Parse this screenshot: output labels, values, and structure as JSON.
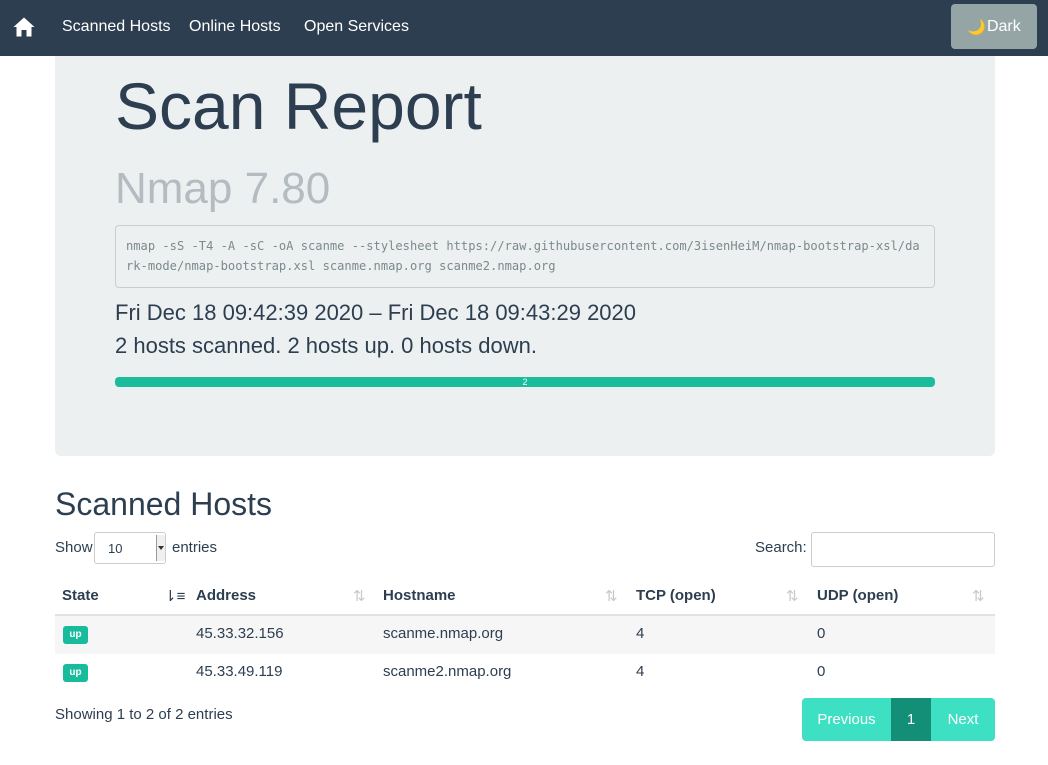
{
  "navbar": {
    "home_icon": "home-icon",
    "links": [
      "Scanned Hosts",
      "Online Hosts",
      "Open Services"
    ],
    "dark_button": {
      "icon": "🌙",
      "label": "Dark"
    }
  },
  "report": {
    "title": "Scan Report",
    "subtitle": "Nmap 7.80",
    "command": "nmap -sS -T4 -A -sC -oA scanme --stylesheet https://raw.githubusercontent.com/3isenHeiM/nmap-bootstrap-xsl/dark-mode/nmap-bootstrap.xsl scanme.nmap.org scanme2.nmap.org",
    "time_range": "Fri Dec 18 09:42:39 2020 – Fri Dec 18 09:43:29 2020",
    "summary": "2 hosts scanned. 2 hosts up. 0 hosts down.",
    "progress": {
      "label": "2",
      "value": 2,
      "total": 2
    }
  },
  "hosts_section": {
    "title": "Scanned Hosts",
    "show_label": "Show",
    "entries_value": "10",
    "entries_label": "entries",
    "search_label": "Search:",
    "search_value": "",
    "columns": [
      "State",
      "Address",
      "Hostname",
      "TCP (open)",
      "UDP (open)"
    ],
    "rows": [
      {
        "state": "up",
        "address": "45.33.32.156",
        "hostname": "scanme.nmap.org",
        "tcp": "4",
        "udp": "0"
      },
      {
        "state": "up",
        "address": "45.33.49.119",
        "hostname": "scanme2.nmap.org",
        "tcp": "4",
        "udp": "0"
      }
    ],
    "info": "Showing 1 to 2 of 2 entries",
    "pagination": {
      "previous": "Previous",
      "current": "1",
      "next": "Next"
    }
  },
  "colors": {
    "navbar": "#2c3e50",
    "accent": "#18bc9c",
    "jumbotron": "#ecf0f1",
    "dark_button": "#95a5a6"
  }
}
